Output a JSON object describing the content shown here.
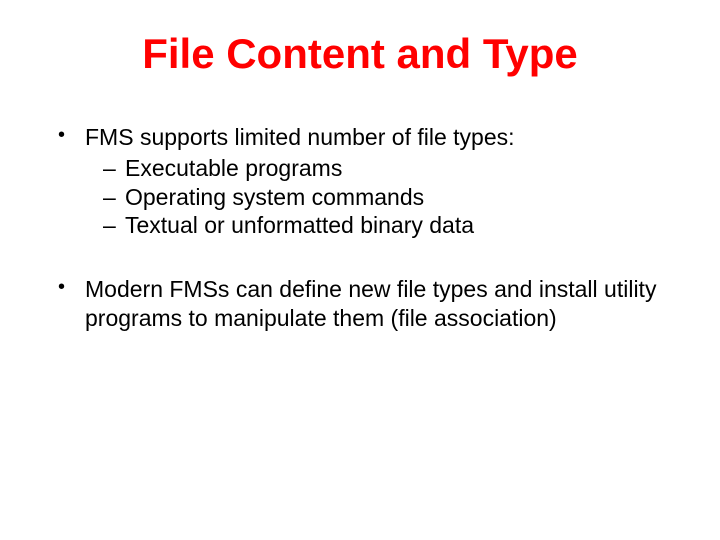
{
  "title": "File Content and Type",
  "bullets": [
    {
      "text": "FMS supports limited number of file types:",
      "sub": [
        "Executable programs",
        "Operating system commands",
        "Textual or unformatted binary data"
      ]
    },
    {
      "text": "Modern FMSs can define new file types and install utility programs to manipulate them (file association)",
      "sub": []
    }
  ]
}
